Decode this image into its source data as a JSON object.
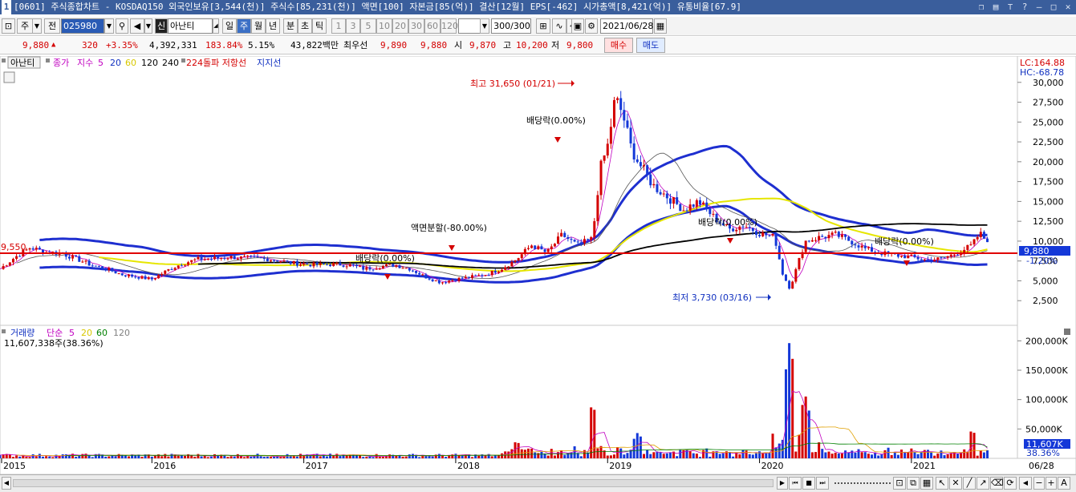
{
  "title": {
    "index": "1",
    "text": "[0601] 주식종합차트 - KOSDAQ150 외국인보유[3,544(천)] 주식수[85,231(천)] 액면[100] 자본금[85(억)] 결산[12월] EPS[-462] 시가총액[8,421(억)] 유통비율[67.9]"
  },
  "toolbar1": {
    "ju_label": "주",
    "jeon_label": "전",
    "code_value": "025980",
    "shin_label": "신",
    "name_value": "아난티",
    "periods": [
      "일",
      "주",
      "월",
      "년",
      "분",
      "초",
      "틱"
    ],
    "selected_period": "주",
    "minutes": [
      "1",
      "3",
      "5",
      "10",
      "20",
      "30",
      "60",
      "120"
    ],
    "count_value": "300/300",
    "date_value": "2021/06/28"
  },
  "quote": {
    "price": "9,880",
    "change_arrow": "▲",
    "change": "320",
    "change_pct": "+3.35%",
    "volume": "4,392,331",
    "vol_ratio": "183.84%",
    "turnover": "5.15%",
    "amount": "43,822백만",
    "best_ask_label": "최우선",
    "best_ask": "9,890",
    "best_bid": "9,880",
    "open_label": "시",
    "open": "9,870",
    "high_label": "고",
    "high": "10,200",
    "low_label": "저",
    "low": "9,800",
    "buy_label": "매수",
    "sell_label": "매도"
  },
  "legend_price": {
    "name": "아난티",
    "close_label": "종가",
    "ma_label": "지수",
    "ma5": "5",
    "ma20": "20",
    "ma60": "60",
    "ma120": "120",
    "ma240": "240",
    "extra": "224돌파 저항선",
    "support": "지지선"
  },
  "lc_hc": {
    "lc": "LC:164.88",
    "hc": "HC:-68.78"
  },
  "annotations": {
    "max": "최고 31,650 (01/21)",
    "min": "최저 3,730 (03/16)",
    "div1": "배당락(0.00%)",
    "div2": "배당락(0.00%)",
    "div3": "배당락(0.00%)",
    "div4": "배당락(0.00%)",
    "split": "액면분할(-80.00%)",
    "hline_value": "9,550",
    "price_tag": "9,880",
    "pct_tag": "-1.20%"
  },
  "legend_volume": {
    "label": "거래량",
    "ma_label": "단순",
    "ma5": "5",
    "ma20": "20",
    "ma60": "60",
    "ma120": "120",
    "current": "11,607,338주(38.36%)",
    "tag_value": "11,607K",
    "tag_pct": "38.36%"
  },
  "chart_data": {
    "type": "line",
    "title": "",
    "x_ticks": [
      "2015",
      "2016",
      "2017",
      "2018",
      "2019",
      "2020",
      "2021",
      "06/28"
    ],
    "price_axis": [
      "30,000",
      "27,500",
      "25,000",
      "22,500",
      "20,000",
      "17,500",
      "15,000",
      "12,500",
      "10,000",
      "7,500",
      "5,000",
      "2,500"
    ],
    "price_ylim": [
      0,
      32500
    ],
    "volume_axis": [
      "200,000K",
      "150,000K",
      "100,000K",
      "50,000K"
    ],
    "volume_ylim": [
      0,
      210000
    ],
    "series": [
      {
        "name": "종가",
        "type": "candlestick",
        "values": [
          [
            2015.0,
            6500
          ],
          [
            2015.1,
            8000
          ],
          [
            2015.2,
            9200
          ],
          [
            2015.3,
            8600
          ],
          [
            2015.4,
            8500
          ],
          [
            2015.5,
            7800
          ],
          [
            2015.6,
            7000
          ],
          [
            2015.7,
            6500
          ],
          [
            2015.8,
            5800
          ],
          [
            2015.9,
            5500
          ],
          [
            2016.0,
            5200
          ],
          [
            2016.1,
            6300
          ],
          [
            2016.2,
            7200
          ],
          [
            2016.3,
            7700
          ],
          [
            2016.4,
            7800
          ],
          [
            2016.5,
            8000
          ],
          [
            2016.6,
            7900
          ],
          [
            2016.7,
            7800
          ],
          [
            2016.8,
            7700
          ],
          [
            2016.9,
            7300
          ],
          [
            2017.0,
            7100
          ],
          [
            2017.1,
            7000
          ],
          [
            2017.2,
            7100
          ],
          [
            2017.3,
            7000
          ],
          [
            2017.4,
            6500
          ],
          [
            2017.5,
            6800
          ],
          [
            2017.6,
            7000
          ],
          [
            2017.7,
            6500
          ],
          [
            2017.8,
            5500
          ],
          [
            2017.9,
            4800
          ],
          [
            2018.0,
            5200
          ],
          [
            2018.1,
            5500
          ],
          [
            2018.2,
            5800
          ],
          [
            2018.3,
            6500
          ],
          [
            2018.4,
            7700
          ],
          [
            2018.5,
            9500
          ],
          [
            2018.6,
            8500
          ],
          [
            2018.7,
            10800
          ],
          [
            2018.8,
            9500
          ],
          [
            2018.9,
            10300
          ],
          [
            2018.95,
            19000
          ],
          [
            2019.0,
            22000
          ],
          [
            2019.05,
            28000
          ],
          [
            2019.1,
            26000
          ],
          [
            2019.15,
            22000
          ],
          [
            2019.2,
            20000
          ],
          [
            2019.3,
            17000
          ],
          [
            2019.4,
            15500
          ],
          [
            2019.5,
            14000
          ],
          [
            2019.6,
            15000
          ],
          [
            2019.7,
            13000
          ],
          [
            2019.8,
            11500
          ],
          [
            2019.9,
            12000
          ],
          [
            2020.0,
            11000
          ],
          [
            2020.1,
            10500
          ],
          [
            2020.15,
            6000
          ],
          [
            2020.2,
            4000
          ],
          [
            2020.25,
            7000
          ],
          [
            2020.3,
            10000
          ],
          [
            2020.4,
            10500
          ],
          [
            2020.5,
            10800
          ],
          [
            2020.6,
            10000
          ],
          [
            2020.7,
            9000
          ],
          [
            2020.8,
            8500
          ],
          [
            2020.9,
            8200
          ],
          [
            2021.0,
            8000
          ],
          [
            2021.1,
            7600
          ],
          [
            2021.2,
            7800
          ],
          [
            2021.3,
            8500
          ],
          [
            2021.4,
            9500
          ],
          [
            2021.45,
            11000
          ],
          [
            2021.5,
            9880
          ]
        ]
      },
      {
        "name": "5",
        "values": "close moving average"
      },
      {
        "name": "20",
        "values": "close moving average"
      },
      {
        "name": "60",
        "values": "close moving average"
      },
      {
        "name": "120",
        "values": "close moving average"
      }
    ],
    "volume_spikes_k": [
      [
        2018.4,
        30000
      ],
      [
        2018.9,
        95000
      ],
      [
        2019.2,
        45000
      ],
      [
        2020.2,
        205000
      ],
      [
        2020.3,
        110000
      ],
      [
        2021.4,
        50000
      ]
    ],
    "colors": {
      "up": "#d40000",
      "down": "#1438d8",
      "ma5": "#ff00ff",
      "ma20": "#e6e600",
      "ma60": "#008000",
      "ma120": "#000000",
      "band": "#1e2fd0",
      "hline": "#e00000"
    }
  }
}
